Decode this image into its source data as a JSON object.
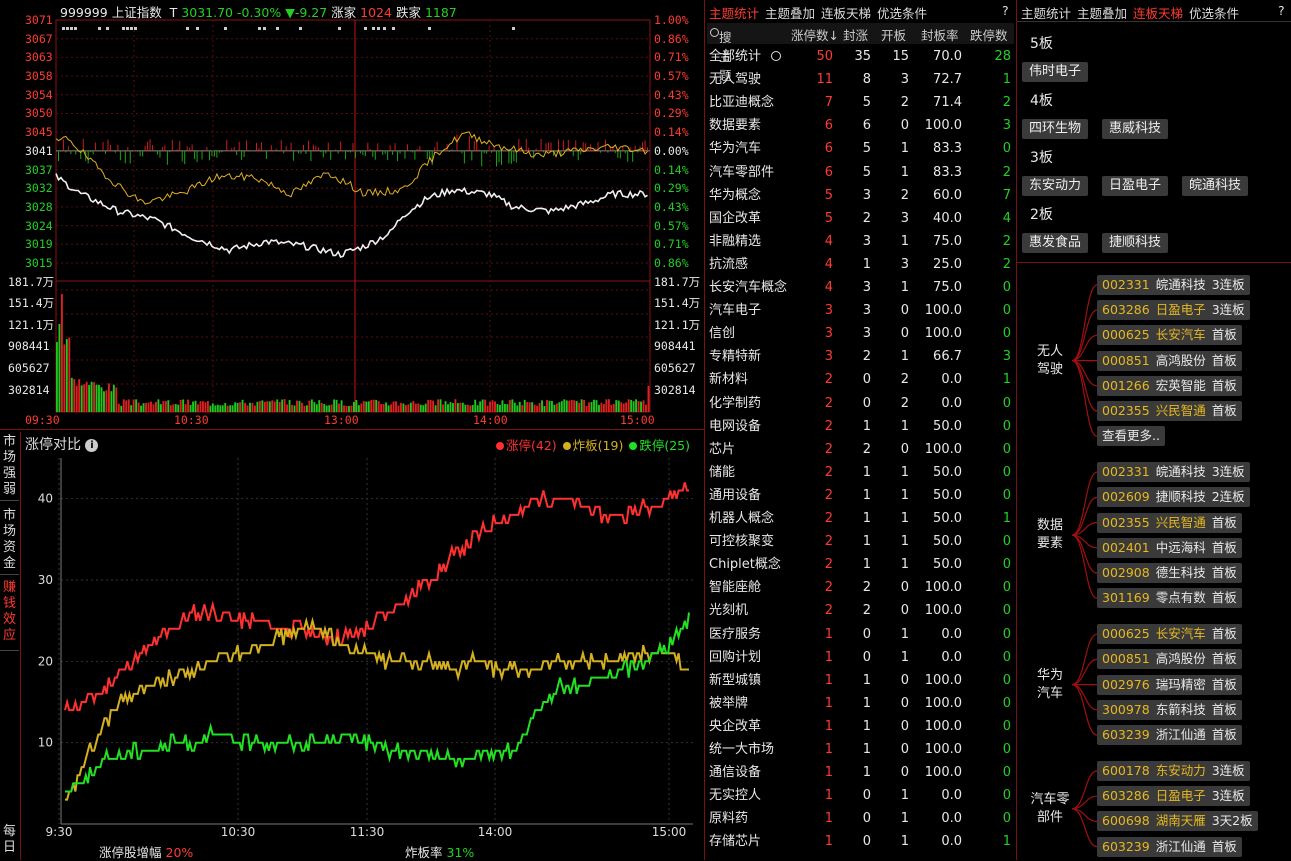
{
  "index_header": {
    "code": "999999",
    "name": "上证指数",
    "marker": "T",
    "price": "3031.70",
    "pct": "-0.30%",
    "change": "▼-9.27",
    "up_label": "涨家",
    "up_count": "1024",
    "down_label": "跌家",
    "down_count": "1187"
  },
  "price_axis_left": [
    "3071",
    "3067",
    "3063",
    "3058",
    "3054",
    "3050",
    "3045",
    "3041",
    "3037",
    "3032",
    "3028",
    "3024",
    "3019",
    "3015"
  ],
  "price_axis_right": [
    "1.00%",
    "0.86%",
    "0.71%",
    "0.57%",
    "0.43%",
    "0.29%",
    "0.14%",
    "0.00%",
    "0.14%",
    "0.29%",
    "0.43%",
    "0.57%",
    "0.71%",
    "0.86%"
  ],
  "volume_axis_left": [
    "181.7万",
    "151.4万",
    "121.1万",
    "908441",
    "605627",
    "302814"
  ],
  "volume_axis_right": [
    "181.7万",
    "151.4万",
    "121.1万",
    "908441",
    "605627",
    "302814"
  ],
  "time_axis": [
    "09:30",
    "10:30",
    "13:00",
    "14:00",
    "15:00"
  ],
  "side_tabs": [
    "市场强弱",
    "市场资金",
    "赚钱效应",
    "每日"
  ],
  "compare_panel": {
    "title": "涨停对比",
    "info_icon": "i",
    "legend": [
      {
        "label": "涨停(42)",
        "color": "#ff3030"
      },
      {
        "label": "炸板(19)",
        "color": "#d4b020"
      },
      {
        "label": "跌停(25)",
        "color": "#22e022"
      }
    ],
    "y_ticks": [
      "40",
      "30",
      "20",
      "10"
    ],
    "x_ticks": [
      "9:30",
      "10:30",
      "11:30",
      "14:00",
      "15:00"
    ],
    "footer_left_label": "涨停股增幅",
    "footer_left_value": "20%",
    "footer_right_label": "炸板率",
    "footer_right_value": "31%"
  },
  "chart_data": {
    "type": "line",
    "x": [
      "9:30",
      "10:30",
      "11:30",
      "14:00",
      "15:00"
    ],
    "ylim": [
      0,
      45
    ],
    "series": [
      {
        "name": "涨停(42)",
        "values": [
          14,
          15,
          17,
          20,
          22,
          24,
          26,
          26,
          25,
          25,
          24,
          24,
          23,
          23,
          24,
          26,
          28,
          30,
          33,
          35,
          37,
          38,
          40,
          40,
          39,
          38,
          38,
          39,
          40,
          42
        ]
      },
      {
        "name": "炸板(19)",
        "values": [
          2,
          8,
          13,
          16,
          17,
          18,
          19,
          20,
          21,
          22,
          23,
          24,
          24,
          22,
          21,
          20,
          20,
          20,
          19,
          20,
          19,
          19,
          19,
          20,
          20,
          20,
          20,
          21,
          21,
          19
        ]
      },
      {
        "name": "跌停(25)",
        "values": [
          4,
          6,
          8,
          9,
          9,
          10,
          10,
          11,
          10,
          10,
          10,
          10,
          10,
          11,
          10,
          9,
          9,
          8,
          8,
          8,
          9,
          9,
          14,
          17,
          17,
          18,
          19,
          20,
          22,
          25
        ]
      }
    ]
  },
  "mid_tabs": [
    "主题统计",
    "主题叠加",
    "连板天梯",
    "优选条件"
  ],
  "mid_active": 0,
  "mid_help": "?",
  "table": {
    "search_label": "搜主题",
    "headers": [
      "涨停数↓",
      "封涨",
      "开板",
      "封板率",
      "跌停数"
    ],
    "rows": [
      [
        "全部统计",
        "50",
        "35",
        "15",
        "70.0",
        "28"
      ],
      [
        "无人驾驶",
        "11",
        "8",
        "3",
        "72.7",
        "1"
      ],
      [
        "比亚迪概念",
        "7",
        "5",
        "2",
        "71.4",
        "2"
      ],
      [
        "数据要素",
        "6",
        "6",
        "0",
        "100.0",
        "3"
      ],
      [
        "华为汽车",
        "6",
        "5",
        "1",
        "83.3",
        "0"
      ],
      [
        "汽车零部件",
        "6",
        "5",
        "1",
        "83.3",
        "2"
      ],
      [
        "华为概念",
        "5",
        "3",
        "2",
        "60.0",
        "7"
      ],
      [
        "国企改革",
        "5",
        "2",
        "3",
        "40.0",
        "4"
      ],
      [
        "非融精选",
        "4",
        "3",
        "1",
        "75.0",
        "2"
      ],
      [
        "抗流感",
        "4",
        "1",
        "3",
        "25.0",
        "2"
      ],
      [
        "长安汽车概念",
        "4",
        "3",
        "1",
        "75.0",
        "0"
      ],
      [
        "汽车电子",
        "3",
        "3",
        "0",
        "100.0",
        "0"
      ],
      [
        "信创",
        "3",
        "3",
        "0",
        "100.0",
        "0"
      ],
      [
        "专精特新",
        "3",
        "2",
        "1",
        "66.7",
        "3"
      ],
      [
        "新材料",
        "2",
        "0",
        "2",
        "0.0",
        "1"
      ],
      [
        "化学制药",
        "2",
        "0",
        "2",
        "0.0",
        "0"
      ],
      [
        "电网设备",
        "2",
        "1",
        "1",
        "50.0",
        "0"
      ],
      [
        "芯片",
        "2",
        "2",
        "0",
        "100.0",
        "0"
      ],
      [
        "储能",
        "2",
        "1",
        "1",
        "50.0",
        "0"
      ],
      [
        "通用设备",
        "2",
        "1",
        "1",
        "50.0",
        "0"
      ],
      [
        "机器人概念",
        "2",
        "1",
        "1",
        "50.0",
        "1"
      ],
      [
        "可控核聚变",
        "2",
        "1",
        "1",
        "50.0",
        "0"
      ],
      [
        "Chiplet概念",
        "2",
        "1",
        "1",
        "50.0",
        "0"
      ],
      [
        "智能座舱",
        "2",
        "2",
        "0",
        "100.0",
        "0"
      ],
      [
        "光刻机",
        "2",
        "2",
        "0",
        "100.0",
        "0"
      ],
      [
        "医疗服务",
        "1",
        "0",
        "1",
        "0.0",
        "0"
      ],
      [
        "回购计划",
        "1",
        "0",
        "1",
        "0.0",
        "0"
      ],
      [
        "新型城镇",
        "1",
        "1",
        "0",
        "100.0",
        "0"
      ],
      [
        "被举牌",
        "1",
        "1",
        "0",
        "100.0",
        "0"
      ],
      [
        "央企改革",
        "1",
        "1",
        "0",
        "100.0",
        "0"
      ],
      [
        "统一大市场",
        "1",
        "1",
        "0",
        "100.0",
        "0"
      ],
      [
        "通信设备",
        "1",
        "1",
        "0",
        "100.0",
        "0"
      ],
      [
        "无实控人",
        "1",
        "0",
        "1",
        "0.0",
        "0"
      ],
      [
        "原料药",
        "1",
        "0",
        "1",
        "0.0",
        "0"
      ],
      [
        "存储芯片",
        "1",
        "0",
        "1",
        "0.0",
        "1"
      ]
    ]
  },
  "right_tabs": [
    "主题统计",
    "主题叠加",
    "连板天梯",
    "优选条件"
  ],
  "right_active": 2,
  "right_help": "?",
  "ladder": [
    {
      "level": "5板",
      "stocks": [
        "伟时电子"
      ]
    },
    {
      "level": "4板",
      "stocks": [
        "四环生物",
        "惠威科技"
      ]
    },
    {
      "level": "3板",
      "stocks": [
        "东安动力",
        "日盈电子",
        "皖通科技"
      ]
    },
    {
      "level": "2板",
      "stocks": [
        "惠发食品",
        "捷顺科技"
      ]
    }
  ],
  "themes": [
    {
      "name": "无人\n驾驶",
      "stocks": [
        {
          "code": "002331",
          "name": "皖通科技",
          "tag": "3连板",
          "hl": false
        },
        {
          "code": "603286",
          "name": "日盈电子",
          "tag": "3连板",
          "hl": true
        },
        {
          "code": "000625",
          "name": "长安汽车",
          "tag": "首板",
          "hl": true
        },
        {
          "code": "000851",
          "name": "高鸿股份",
          "tag": "首板",
          "hl": false
        },
        {
          "code": "001266",
          "name": "宏英智能",
          "tag": "首板",
          "hl": false
        },
        {
          "code": "002355",
          "name": "兴民智通",
          "tag": "首板",
          "hl": true
        }
      ],
      "more": "查看更多.."
    },
    {
      "name": "数据\n要素",
      "stocks": [
        {
          "code": "002331",
          "name": "皖通科技",
          "tag": "3连板",
          "hl": false
        },
        {
          "code": "002609",
          "name": "捷顺科技",
          "tag": "2连板",
          "hl": false
        },
        {
          "code": "002355",
          "name": "兴民智通",
          "tag": "首板",
          "hl": true
        },
        {
          "code": "002401",
          "name": "中远海科",
          "tag": "首板",
          "hl": false
        },
        {
          "code": "002908",
          "name": "德生科技",
          "tag": "首板",
          "hl": false
        },
        {
          "code": "301169",
          "name": "零点有数",
          "tag": "首板",
          "hl": false
        }
      ]
    },
    {
      "name": "华为\n汽车",
      "stocks": [
        {
          "code": "000625",
          "name": "长安汽车",
          "tag": "首板",
          "hl": true
        },
        {
          "code": "000851",
          "name": "高鸿股份",
          "tag": "首板",
          "hl": false
        },
        {
          "code": "002976",
          "name": "瑞玛精密",
          "tag": "首板",
          "hl": false
        },
        {
          "code": "300978",
          "name": "东箭科技",
          "tag": "首板",
          "hl": false
        },
        {
          "code": "603239",
          "name": "浙江仙通",
          "tag": "首板",
          "hl": false
        }
      ]
    },
    {
      "name": "汽车零\n部件",
      "stocks": [
        {
          "code": "600178",
          "name": "东安动力",
          "tag": "3连板",
          "hl": true
        },
        {
          "code": "603286",
          "name": "日盈电子",
          "tag": "3连板",
          "hl": true
        },
        {
          "code": "600698",
          "name": "湖南天雁",
          "tag": "3天2板",
          "hl": true
        },
        {
          "code": "603239",
          "name": "浙江仙通",
          "tag": "首板",
          "hl": false
        }
      ]
    }
  ]
}
